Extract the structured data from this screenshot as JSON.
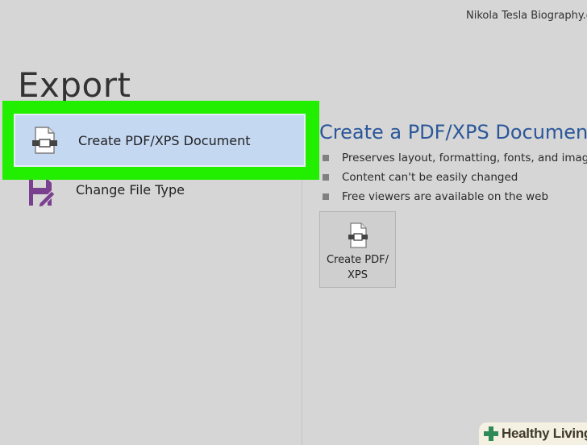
{
  "header": {
    "document_title": "Nikola Tesla Biography.docx"
  },
  "page": {
    "heading": "Export"
  },
  "options": [
    {
      "label": "Create PDF/XPS Document",
      "icon": "pdf-document-icon",
      "selected": true
    },
    {
      "label": "Change File Type",
      "icon": "change-file-type-icon",
      "selected": false
    }
  ],
  "detail": {
    "title": "Create a PDF/XPS Document",
    "bullets": [
      "Preserves layout, formatting, fonts, and images",
      "Content can't be easily changed",
      "Free viewers are available on the web"
    ],
    "button_label": "Create PDF/ XPS"
  },
  "watermark": {
    "text": "Healthy Living",
    "icon": "plus-cross-icon"
  },
  "colors": {
    "accent_blue": "#2b579a",
    "selected_bg": "#c5d8f2",
    "highlight_green": "#22ee00",
    "background": "#d6d6d6",
    "change_icon_purple": "#7a3f8f"
  }
}
